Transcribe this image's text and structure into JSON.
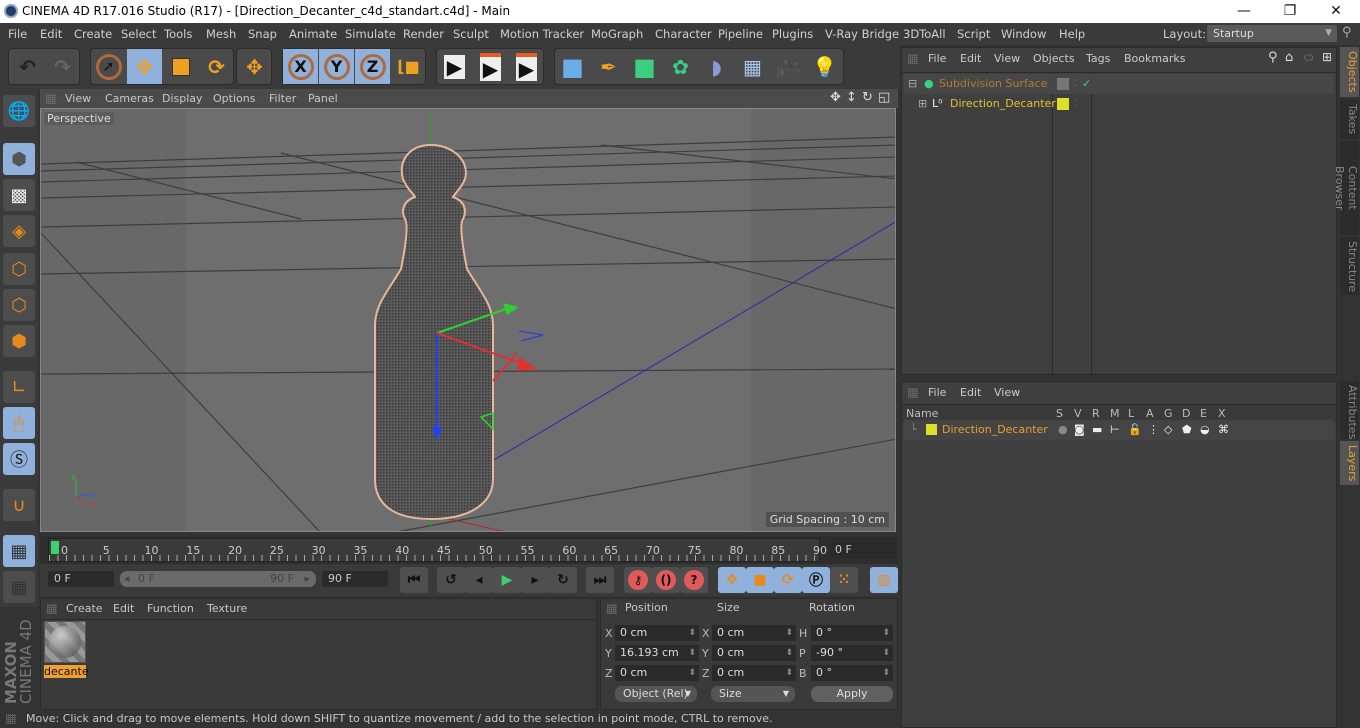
{
  "window": {
    "title": "CINEMA 4D R17.016 Studio (R17) - [Direction_Decanter_c4d_standart.c4d] - Main",
    "minimize": "—",
    "maximize": "❐",
    "close": "✕"
  },
  "menubar": {
    "items": [
      "File",
      "Edit",
      "Create",
      "Select",
      "Tools",
      "Mesh",
      "Snap",
      "Animate",
      "Simulate",
      "Render",
      "Sculpt",
      "Motion Tracker",
      "MoGraph",
      "Character",
      "Pipeline",
      "Plugins",
      "V-Ray Bridge",
      "3DToAll",
      "Script",
      "Window",
      "Help"
    ],
    "layout_label": "Layout:",
    "layout_value": "Startup"
  },
  "toolbar": {
    "undo": "↶",
    "redo": "↷",
    "x": "X",
    "y": "Y",
    "z": "Z"
  },
  "viewport": {
    "menu": [
      "View",
      "Cameras",
      "Display",
      "Options",
      "Filter",
      "Panel"
    ],
    "camera_label": "Perspective",
    "grid_spacing": "Grid Spacing : 10 cm"
  },
  "timeline": {
    "ticks": [
      "0",
      "5",
      "10",
      "15",
      "20",
      "25",
      "30",
      "35",
      "40",
      "45",
      "50",
      "55",
      "60",
      "65",
      "70",
      "75",
      "80",
      "85",
      "90"
    ],
    "current_frame": "0 F",
    "start_field": "0 F",
    "range_start": "0 F",
    "range_end": "90 F",
    "end_field": "90 F"
  },
  "material_panel": {
    "menu": [
      "Create",
      "Edit",
      "Function",
      "Texture"
    ],
    "materials": [
      {
        "name": "decante"
      }
    ]
  },
  "coordinates": {
    "headers": {
      "position": "Position",
      "size": "Size",
      "rotation": "Rotation"
    },
    "position": {
      "x": "0 cm",
      "y": "16.193 cm",
      "z": "0 cm"
    },
    "size": {
      "x": "0 cm",
      "y": "0 cm",
      "z": "0 cm"
    },
    "rotation": {
      "h": "0 °",
      "p": "-90 °",
      "b": "0 °"
    },
    "labels": {
      "x": "X",
      "y": "Y",
      "z": "Z",
      "h": "H",
      "p": "P",
      "b": "B"
    },
    "mode": "Object (Rel)",
    "size_mode": "Size",
    "apply": "Apply"
  },
  "status": "Move: Click and drag to move elements. Hold down SHIFT to quantize movement / add to the selection in point mode, CTRL to remove.",
  "objects_panel": {
    "menu": [
      "File",
      "Edit",
      "View",
      "Objects",
      "Tags",
      "Bookmarks"
    ],
    "objects": [
      {
        "name": "Subdivision Surface",
        "check": "✓"
      },
      {
        "name": "Direction_Decanter"
      }
    ]
  },
  "layers_panel": {
    "menu": [
      "File",
      "Edit",
      "View"
    ],
    "columns": [
      "Name",
      "S",
      "V",
      "R",
      "M",
      "L",
      "A",
      "G",
      "D",
      "E",
      "X"
    ],
    "layers": [
      {
        "name": "Direction_Decanter",
        "color": "#dede2a"
      }
    ]
  },
  "side_tabs": {
    "top": [
      "Objects",
      "Takes",
      "Content Browser",
      "Structure"
    ],
    "bottom": [
      "Attributes",
      "Layers"
    ]
  },
  "brand": {
    "line1": "MAXON",
    "line2": "CINEMA 4D"
  },
  "colors": {
    "accent": "#e8a030",
    "selected_tool": "#8fb1db"
  }
}
